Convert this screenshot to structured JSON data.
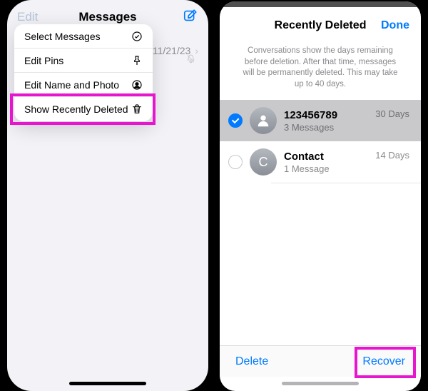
{
  "left": {
    "header": {
      "title": "Messages",
      "edit": "Edit"
    },
    "menu": [
      {
        "label": "Select Messages",
        "icon": "select"
      },
      {
        "label": "Edit Pins",
        "icon": "pin"
      },
      {
        "label": "Edit Name and Photo",
        "icon": "person-circle"
      },
      {
        "label": "Show Recently Deleted",
        "icon": "trash"
      }
    ],
    "conversation": {
      "date": "11/21/23"
    }
  },
  "right": {
    "header": {
      "title": "Recently Deleted",
      "done": "Done"
    },
    "info": "Conversations show the days remaining before deletion. After that time, messages will be permanently deleted. This may take up to 40 days.",
    "conversations": [
      {
        "title": "123456789",
        "sub": "3 Messages",
        "days": "30 Days",
        "selected": true,
        "initial": ""
      },
      {
        "title": "Contact",
        "sub": "1 Message",
        "days": "14 Days",
        "selected": false,
        "initial": "C"
      }
    ],
    "toolbar": {
      "delete": "Delete",
      "recover": "Recover"
    }
  }
}
